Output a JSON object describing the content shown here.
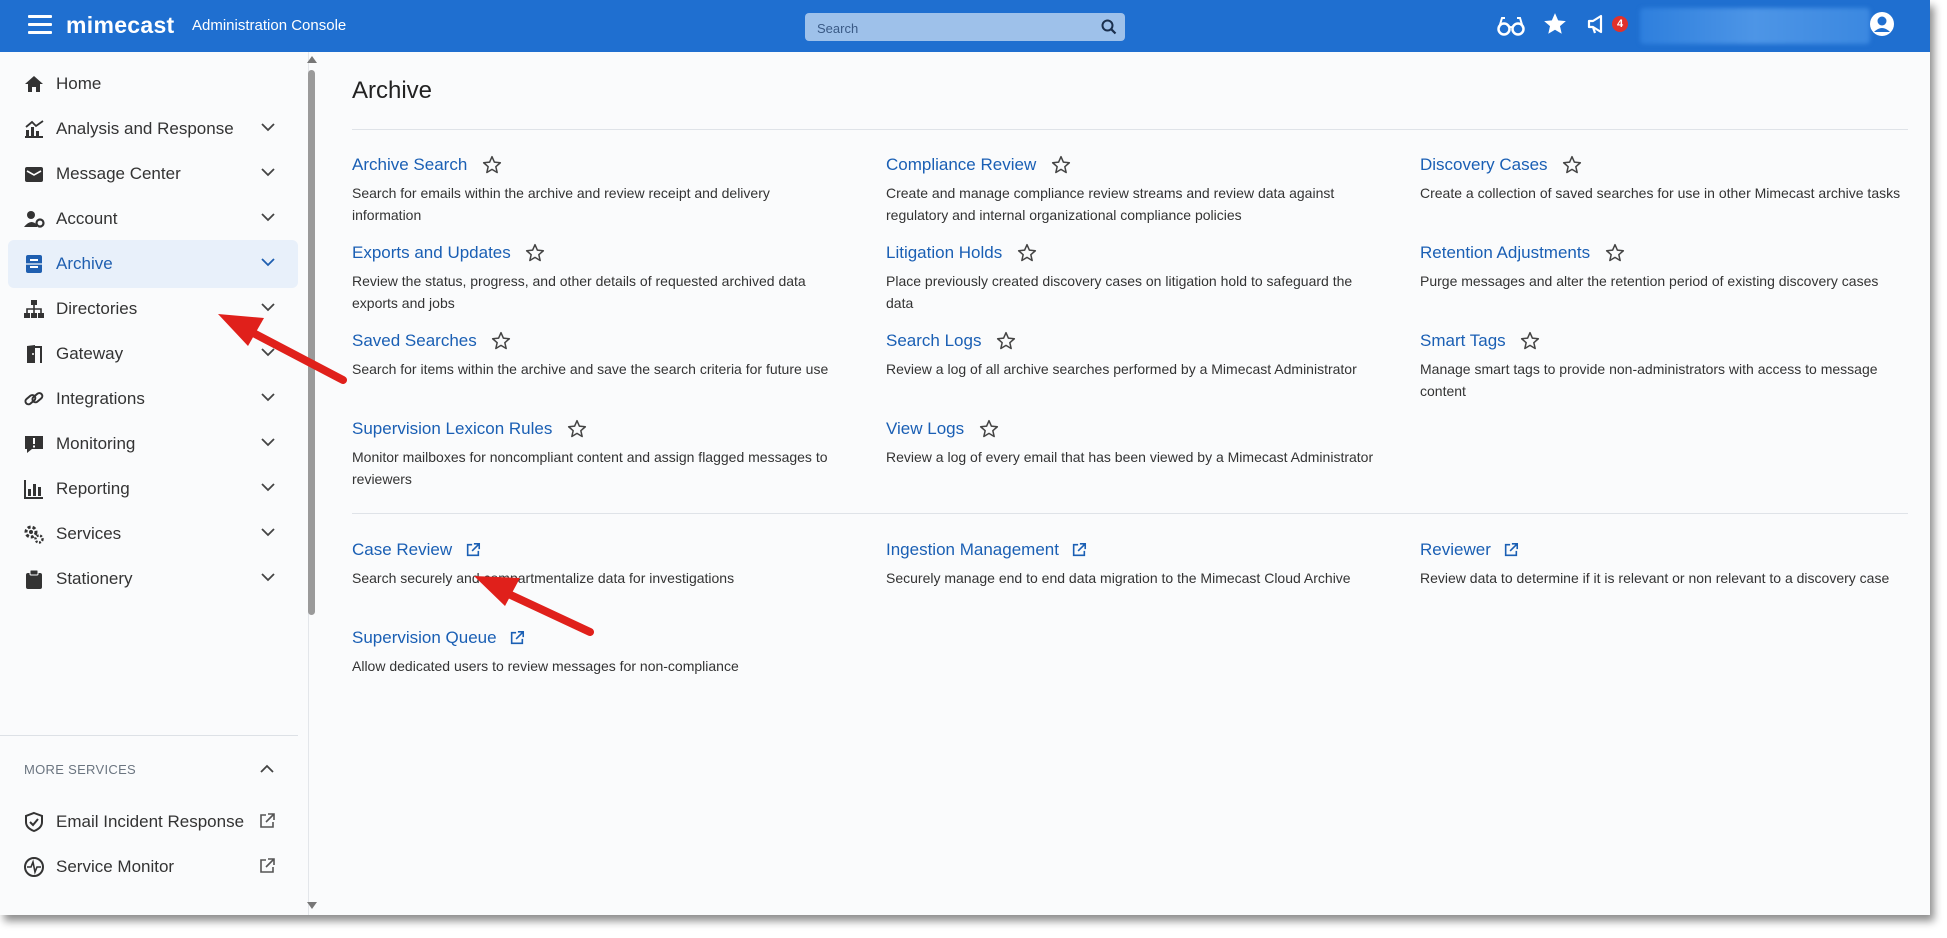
{
  "header": {
    "brand": "mimecast",
    "console_title": "Administration Console",
    "search_placeholder": "Search",
    "notifications_count": "4"
  },
  "sidebar": {
    "items": [
      {
        "label": "Home",
        "icon": "home-icon"
      },
      {
        "label": "Analysis and Response",
        "icon": "analytics-icon"
      },
      {
        "label": "Message Center",
        "icon": "message-center-icon"
      },
      {
        "label": "Account",
        "icon": "account-gear-icon"
      },
      {
        "label": "Archive",
        "icon": "archive-icon",
        "active": true
      },
      {
        "label": "Directories",
        "icon": "directories-icon"
      },
      {
        "label": "Gateway",
        "icon": "gateway-icon"
      },
      {
        "label": "Integrations",
        "icon": "integrations-icon"
      },
      {
        "label": "Monitoring",
        "icon": "monitoring-icon"
      },
      {
        "label": "Reporting",
        "icon": "reporting-icon"
      },
      {
        "label": "Services",
        "icon": "services-icon"
      },
      {
        "label": "Stationery",
        "icon": "stationery-icon"
      }
    ],
    "more_services_label": "MORE SERVICES",
    "more_services": [
      {
        "label": "Email Incident Response",
        "icon": "shield-check-icon"
      },
      {
        "label": "Service Monitor",
        "icon": "service-monitor-icon"
      }
    ]
  },
  "main": {
    "title": "Archive",
    "favorites_section": [
      {
        "title": "Archive Search",
        "desc": "Search for emails within the archive and review receipt and delivery information"
      },
      {
        "title": "Compliance Review",
        "desc": "Create and manage compliance review streams and review data against regulatory and internal organizational compliance policies"
      },
      {
        "title": "Discovery Cases",
        "desc": "Create a collection of saved searches for use in other Mimecast archive tasks"
      },
      {
        "title": "Exports and Updates",
        "desc": "Review the status, progress, and other details of requested archived data exports and jobs"
      },
      {
        "title": "Litigation Holds",
        "desc": "Place previously created discovery cases on litigation hold to safeguard the data"
      },
      {
        "title": "Retention Adjustments",
        "desc": "Purge messages and alter the retention period of existing discovery cases"
      },
      {
        "title": "Saved Searches",
        "desc": "Search for items within the archive and save the search criteria for future use"
      },
      {
        "title": "Search Logs",
        "desc": "Review a log of all archive searches performed by a Mimecast Administrator"
      },
      {
        "title": "Smart Tags",
        "desc": "Manage smart tags to provide non-administrators with access to message content"
      },
      {
        "title": "Supervision Lexicon Rules",
        "desc": "Monitor mailboxes for noncompliant content and assign flagged messages to reviewers"
      },
      {
        "title": "View Logs",
        "desc": "Review a log of every email that has been viewed by a Mimecast Administrator"
      }
    ],
    "external_section": [
      {
        "title": "Case Review",
        "desc": "Search securely and compartmentalize data for investigations"
      },
      {
        "title": "Ingestion Management",
        "desc": "Securely manage end to end data migration to the Mimecast Cloud Archive"
      },
      {
        "title": "Reviewer",
        "desc": "Review data to determine if it is relevant or non relevant to a discovery case"
      },
      {
        "title": "Supervision Queue",
        "desc": "Allow dedicated users to review messages for non-compliance"
      }
    ]
  },
  "colors": {
    "header_bg": "#1f6fd0",
    "link": "#1a5fb4",
    "active_bg": "#e8f0fa",
    "annotation_arrow": "#e0201b"
  }
}
